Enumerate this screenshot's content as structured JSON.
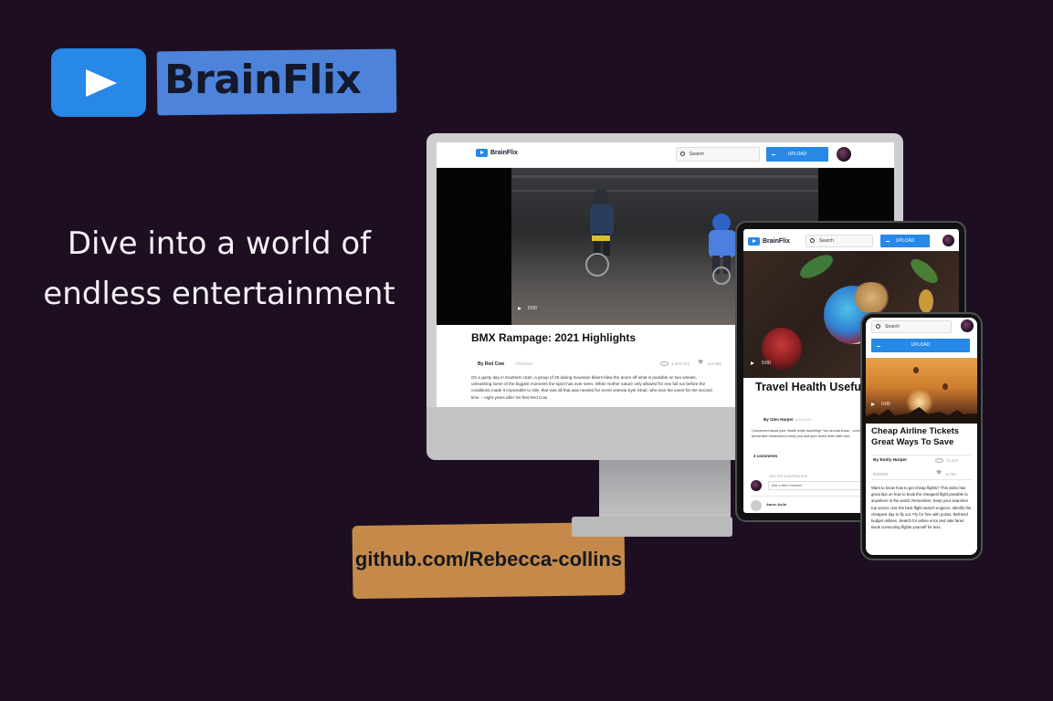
{
  "brand": {
    "name": "BrainFlix",
    "play_color": "#2788e8",
    "word_highlight": "#4d83db"
  },
  "hero": {
    "tagline_line1": "Dive into a world of",
    "tagline_line2": "endless entertainment",
    "github_link": "github.com/Rebecca-collins",
    "github_highlight": "#c58a4a"
  },
  "desktop": {
    "logo": "BrainFlix",
    "search_placeholder": "Search",
    "upload_label": "UPLOAD",
    "video_time": "0:00",
    "title": "BMX Rampage: 2021 Highlights",
    "author": "By Red Cow",
    "date": "7/11/2021",
    "views": "1,001,023",
    "likes": "110,985",
    "description": "On a gusty day in Southern Utah, a group of 25 daring mountain bikers blew the doors off what is possible on two wheels, unleashing some of the biggest moments the sport has ever seen. While mother nature only allowed for one full run before the conditions made it impossible to ride, that was all that was needed for event veteran Kyle Strait, who won the event for the second time -- eight years after his first Red Cow"
  },
  "tablet": {
    "logo": "BrainFlix",
    "search_placeholder": "Search",
    "upload_label": "UPLOAD",
    "video_time": "0:00",
    "title": "Travel Health Useful Information For",
    "author": "By Glen Harper",
    "date": "5/10/2021",
    "description": "Concerned about your health while travelling? You should know... concerned about their health and safety. This video provides so... preventive measures to keep you and your loved ones safe duri...",
    "comments_count": "3 comments",
    "join_label": "JOIN THE CONVERSATION",
    "comment_placeholder": "Add a New Comment",
    "commenter_name": "Aaron Avila"
  },
  "phone": {
    "search_placeholder": "Search",
    "upload_label": "UPLOAD",
    "video_time": "0:00",
    "title": "Cheap Airline Tickets Great Ways To Save",
    "author": "By Emily Harper",
    "views": "72,342",
    "date": "9/3/2021",
    "likes": "8,785",
    "description": "Want to know how to get cheap flights? This video has great tips on how to book the cheapest flight possible to anywhere in the world. Remember, Keep your searches top secret. Use the best flight search engines. Identify the cheapest day to fly out. Fly for free with points. Befriend budget airlines. Search for airline error and sale fares. Book connecting flights yourself for less."
  }
}
